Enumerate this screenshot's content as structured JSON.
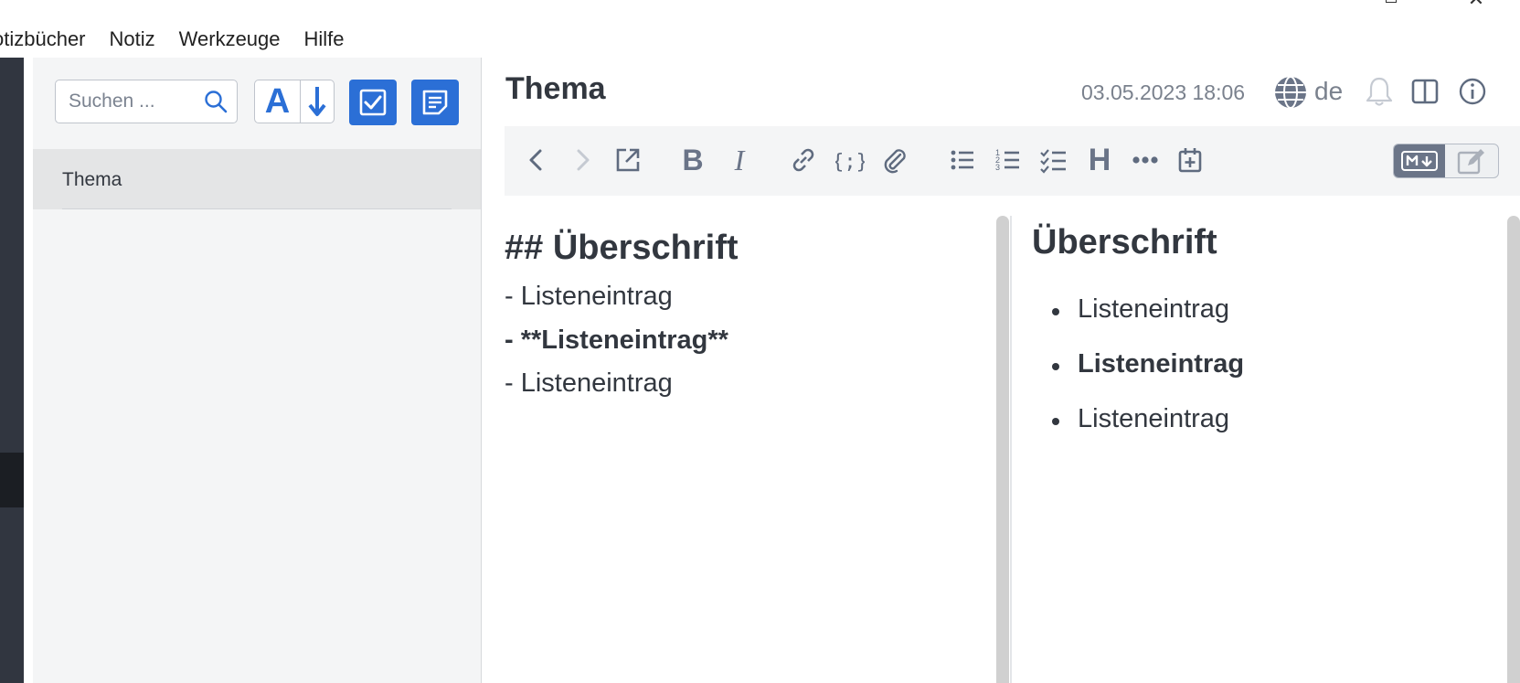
{
  "menu": {
    "items": [
      {
        "label": "otizbücher"
      },
      {
        "label": "Notiz"
      },
      {
        "label": "Werkzeuge"
      },
      {
        "label": "Hilfe"
      }
    ]
  },
  "window": {
    "close_glyph": "✕"
  },
  "note_list": {
    "search_placeholder": "Suchen ...",
    "sort_alpha_label": "A",
    "notes": [
      {
        "title": "Thema"
      }
    ]
  },
  "editor": {
    "title": "Thema",
    "date": "03.05.2023 18:06",
    "language": "de",
    "heading_button_label": "H",
    "markdown": {
      "heading": "## Überschrift",
      "lines": [
        {
          "text": "- Listeneintrag",
          "bold": false
        },
        {
          "text": "- **Listeneintrag**",
          "bold": true
        },
        {
          "text": "- Listeneintrag",
          "bold": false
        }
      ]
    },
    "preview": {
      "heading": "Überschrift",
      "items": [
        {
          "text": "Listeneintrag",
          "bold": false
        },
        {
          "text": "Listeneintrag",
          "bold": true
        },
        {
          "text": "Listeneintrag",
          "bold": false
        }
      ]
    }
  },
  "colors": {
    "accent": "#2b6fd6",
    "sidebar_dark": "#313640",
    "panel_bg": "#f4f5f6",
    "selected_row": "#e4e5e6",
    "text": "#32373f",
    "muted": "#7a818d"
  },
  "icons": {
    "toolbar": [
      "back-arrow-icon",
      "forward-arrow-icon",
      "external-edit-icon",
      "bold-icon",
      "italic-icon",
      "link-icon",
      "code-icon",
      "attachment-icon",
      "bullet-list-icon",
      "numbered-list-icon",
      "checkbox-list-icon",
      "heading-icon",
      "more-icon",
      "insert-date-icon",
      "markdown-mode-icon",
      "wysiwyg-mode-icon"
    ],
    "header": [
      "globe-icon",
      "bell-icon",
      "layout-toggle-icon",
      "info-icon"
    ]
  }
}
